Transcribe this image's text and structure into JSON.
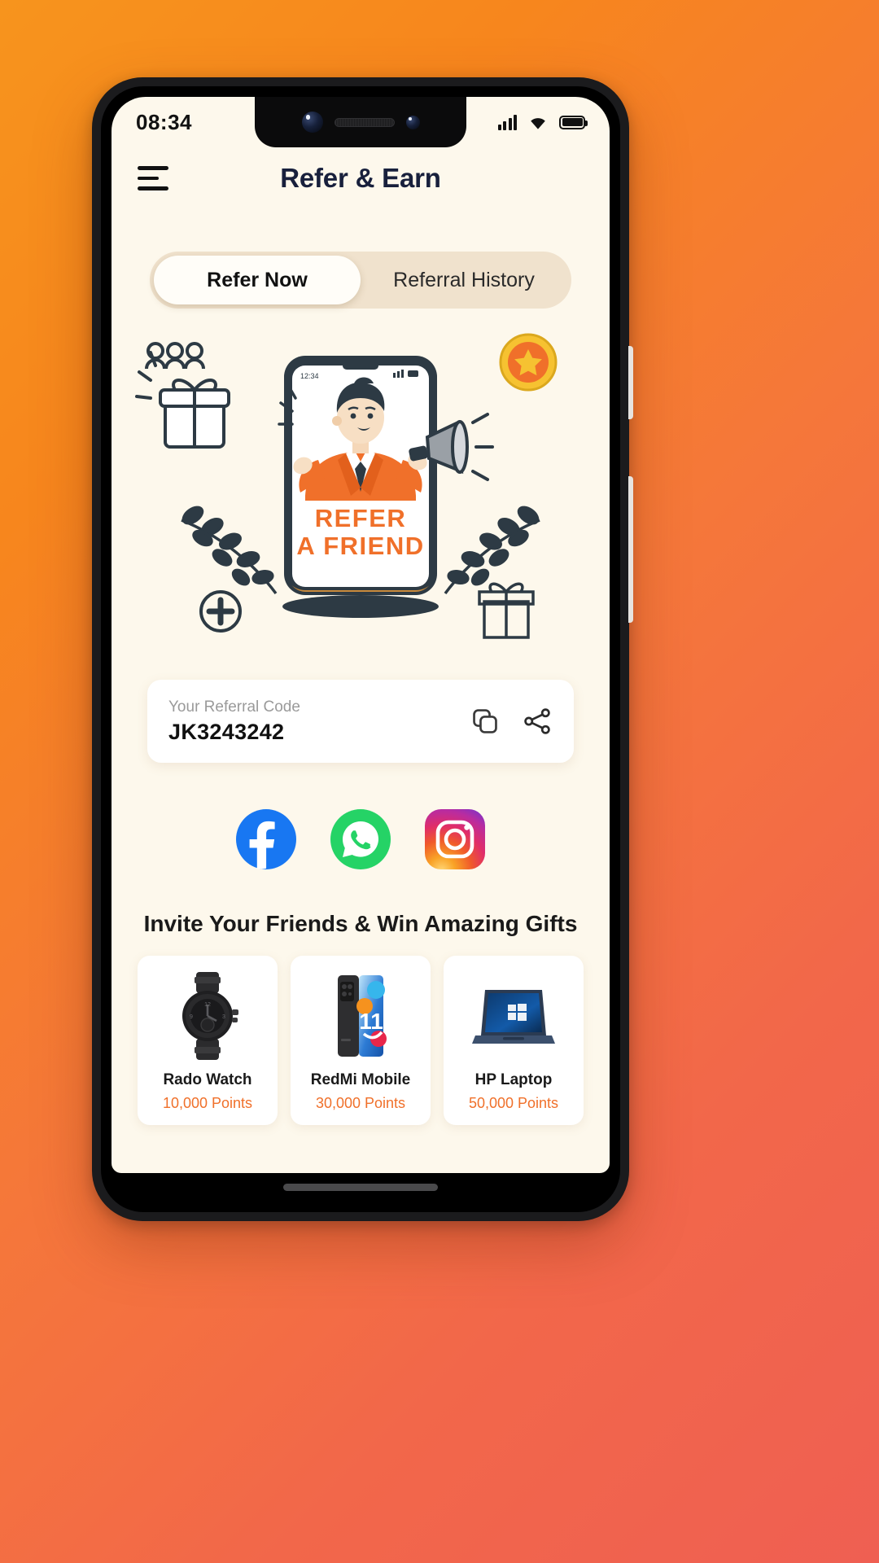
{
  "status_bar": {
    "time": "08:34",
    "signal_icon": "signal-bars-icon",
    "wifi_icon": "wifi-icon",
    "battery_icon": "battery-full-icon"
  },
  "header": {
    "title": "Refer & Earn",
    "menu_icon": "hamburger-menu-icon"
  },
  "tabs": [
    {
      "label": "Refer Now",
      "active": true
    },
    {
      "label": "Referral History",
      "active": false
    }
  ],
  "hero": {
    "illustration_name": "refer-a-friend-illustration",
    "phone_text_line1": "REFER",
    "phone_text_line2": "A FRIEND"
  },
  "referral": {
    "label": "Your Referral Code",
    "code": "JK3243242",
    "copy_icon": "copy-icon",
    "share_icon": "share-icon"
  },
  "social": [
    {
      "name": "facebook",
      "label": "Facebook"
    },
    {
      "name": "whatsapp",
      "label": "WhatsApp"
    },
    {
      "name": "instagram",
      "label": "Instagram"
    }
  ],
  "gifts_section": {
    "heading": "Invite Your Friends & Win Amazing Gifts",
    "items": [
      {
        "name": "Rado Watch",
        "points": "10,000 Points",
        "image": "watch-image"
      },
      {
        "name": "RedMi Mobile",
        "points": "30,000 Points",
        "image": "smartphone-image"
      },
      {
        "name": "HP Laptop",
        "points": "50,000 Points",
        "image": "laptop-image"
      }
    ]
  },
  "colors": {
    "background_gradient_start": "#f7941d",
    "background_gradient_end": "#ef5f52",
    "screen_background": "#fdf8ec",
    "accent_orange": "#f0702a",
    "title_navy": "#18203c",
    "tab_track": "#f0e2cd"
  }
}
